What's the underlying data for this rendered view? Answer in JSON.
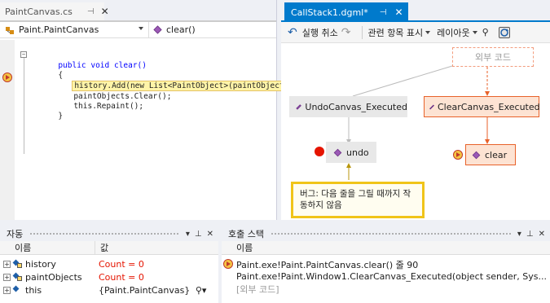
{
  "editor": {
    "tab_label": "PaintCanvas.cs",
    "tab_pin": "⊣",
    "tab_close": "✕",
    "nav_class": "Paint.PaintCanvas",
    "nav_member": "clear()",
    "code": {
      "collapse": "−",
      "line1": "public void clear()",
      "line2": "{",
      "line3": "history.Add(new List<PaintObject>(paintObjects));",
      "line4": "paintObjects.Clear();",
      "line5": "this.Repaint();",
      "line6": "}"
    }
  },
  "diagram": {
    "tab_label": "CallStack1.dgml*",
    "tab_pin": "⊣",
    "tab_close": "✕",
    "toolbar": {
      "undo_label": "실행 취소",
      "related_label": "관련 항목 표시",
      "layout_label": "레이아웃"
    },
    "nodes": {
      "external": "외부 코드",
      "undo_canvas": "UndoCanvas_Executed",
      "clear_canvas": "ClearCanvas_Executed",
      "undo": "undo",
      "clear": "clear"
    },
    "comment": "버그: 다음 줄을 그릴 때까지 작동하지 않음"
  },
  "autos": {
    "title": "자동",
    "col_name": "이름",
    "col_value": "값",
    "rows": [
      {
        "name": "history",
        "value": "Count = 0"
      },
      {
        "name": "paintObjects",
        "value": "Count = 0"
      },
      {
        "name": "this",
        "value": "{Paint.PaintCanvas}"
      }
    ]
  },
  "callstack": {
    "title": "호출 스택",
    "col_name": "이름",
    "rows": [
      "Paint.exe!Paint.PaintCanvas.clear() 줄 90",
      "Paint.exe!Paint.Window1.ClearCanvas_Executed(object sender, Sys...",
      "[외부 코드]"
    ]
  },
  "colors": {
    "accent": "#007acc",
    "breakpoint": "#e51400",
    "changed_value": "#e51400",
    "highlight": "#fff4a8",
    "comment_border": "#f0c419",
    "node_orange": "#e8622a"
  }
}
